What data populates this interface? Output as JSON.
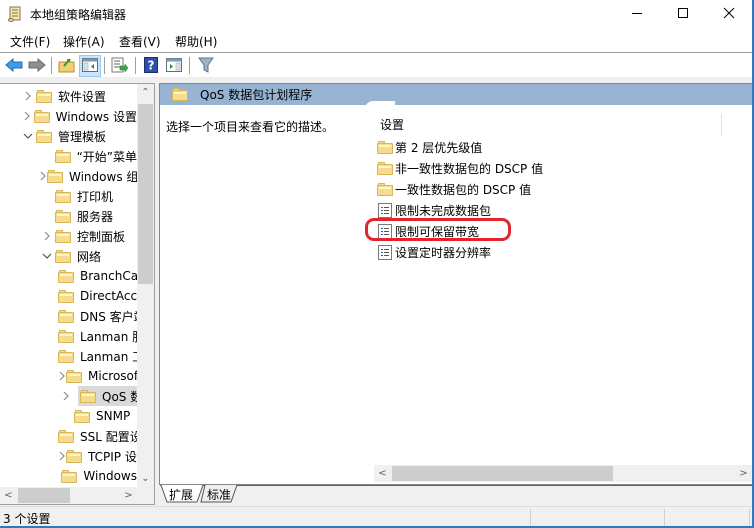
{
  "window": {
    "title": "本地组策略编辑器",
    "app_icon": "scroll-icon",
    "controls": {
      "minimize": "minimize-icon",
      "maximize": "maximize-icon",
      "close": "close-icon"
    }
  },
  "menu": [
    {
      "label": "文件(F)"
    },
    {
      "label": "操作(A)"
    },
    {
      "label": "查看(V)"
    },
    {
      "label": "帮助(H)"
    }
  ],
  "toolbar": {
    "buttons": [
      {
        "name": "back",
        "icon": "back-arrow-icon"
      },
      {
        "name": "forward",
        "icon": "forward-arrow-icon"
      },
      {
        "name": "up-one-level",
        "icon": "folder-up-icon"
      },
      {
        "name": "show-hide-console-tree",
        "icon": "console-tree-icon",
        "active": true
      },
      {
        "name": "export-list",
        "icon": "export-list-icon"
      },
      {
        "name": "help",
        "icon": "help-icon"
      },
      {
        "name": "show-hide-action-pane",
        "icon": "action-pane-icon"
      },
      {
        "name": "filter",
        "icon": "filter-icon"
      }
    ]
  },
  "tree": {
    "items": [
      {
        "label": "软件设置",
        "expander": ">",
        "level": 1
      },
      {
        "label": "Windows 设置",
        "expander": ">",
        "level": 1
      },
      {
        "label": "管理模板",
        "expander": "v",
        "level": 1
      },
      {
        "label": "“开始”菜单",
        "expander": "",
        "level": 2
      },
      {
        "label": "Windows 组件",
        "expander": ">",
        "level": 2
      },
      {
        "label": "打印机",
        "expander": "",
        "level": 2
      },
      {
        "label": "服务器",
        "expander": "",
        "level": 2
      },
      {
        "label": "控制面板",
        "expander": ">",
        "level": 2
      },
      {
        "label": "网络",
        "expander": "v",
        "level": 2
      },
      {
        "label": "BranchCache",
        "expander": "",
        "level": 3
      },
      {
        "label": "DirectAccess",
        "expander": "",
        "level": 3
      },
      {
        "label": "DNS 客户端",
        "expander": "",
        "level": 3
      },
      {
        "label": "Lanman 服务器",
        "expander": "",
        "level": 3
      },
      {
        "label": "Lanman 工作站",
        "expander": "",
        "level": 3
      },
      {
        "label": "Microsoft",
        "expander": ">",
        "level": 3
      },
      {
        "label": "QoS 数据包计划程序",
        "expander": ">",
        "level": 3,
        "selected": true
      },
      {
        "label": "SNMP",
        "expander": "",
        "level": 3
      },
      {
        "label": "SSL 配置设置",
        "expander": "",
        "level": 3
      },
      {
        "label": "TCPIP 设置",
        "expander": ">",
        "level": 3
      },
      {
        "label": "Windows",
        "expander": "",
        "level": 3
      }
    ]
  },
  "details": {
    "header_title": "QoS 数据包计划程序",
    "description": "选择一个项目来查看它的描述。",
    "column_header": "设置",
    "items": [
      {
        "label": "第 2 层优先级值",
        "type": "folder"
      },
      {
        "label": "非一致性数据包的 DSCP 值",
        "type": "folder"
      },
      {
        "label": "一致性数据包的 DSCP 值",
        "type": "folder"
      },
      {
        "label": "限制未完成数据包",
        "type": "setting"
      },
      {
        "label": "限制可保留带宽",
        "type": "setting",
        "highlighted": true
      },
      {
        "label": "设置定时器分辨率",
        "type": "setting"
      }
    ],
    "highlight_color": "#e1262d"
  },
  "tabs": [
    {
      "label": "扩展",
      "active": true
    },
    {
      "label": "标准",
      "active": false
    }
  ],
  "statusbar": {
    "text": "3 个设置"
  },
  "colors": {
    "header_bg": "#97b3d2",
    "selected_bg": "#d9d9d9",
    "accent_border": "#2b7bc4"
  }
}
